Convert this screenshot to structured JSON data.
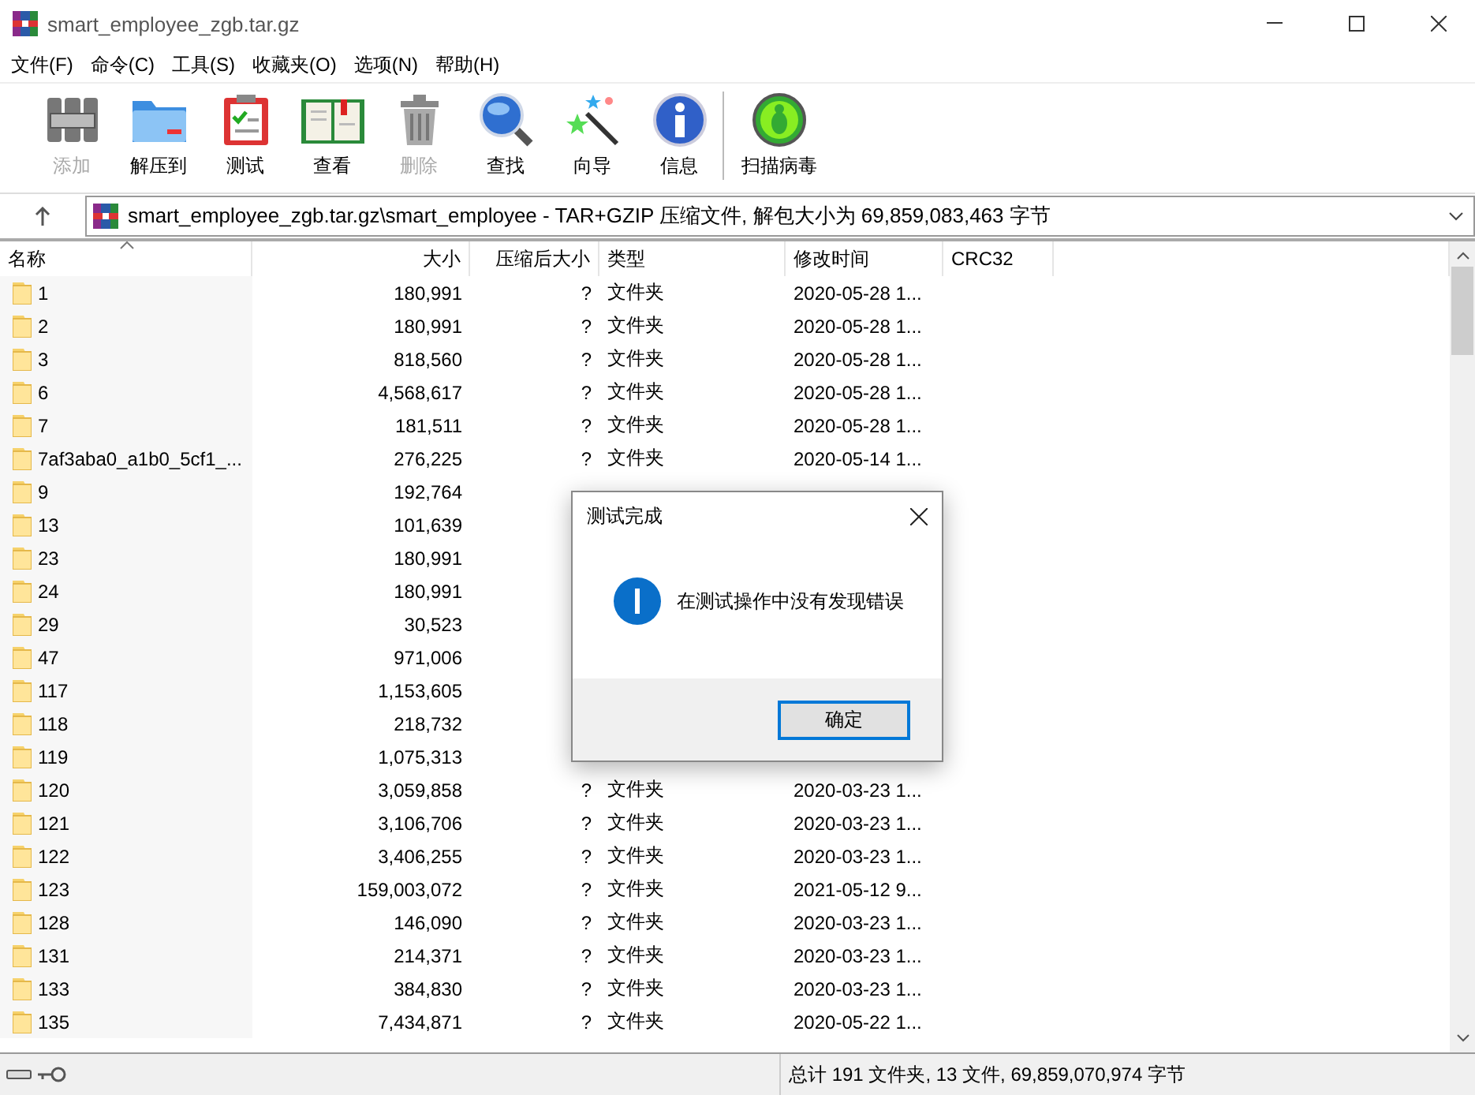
{
  "window": {
    "title": "smart_employee_zgb.tar.gz"
  },
  "menu": [
    "文件(F)",
    "命令(C)",
    "工具(S)",
    "收藏夹(O)",
    "选项(N)",
    "帮助(H)"
  ],
  "toolbar": [
    {
      "kind": "add",
      "label": "添加",
      "disabled": true
    },
    {
      "kind": "extract",
      "label": "解压到",
      "disabled": false
    },
    {
      "kind": "test",
      "label": "测试",
      "disabled": false
    },
    {
      "kind": "view",
      "label": "查看",
      "disabled": false
    },
    {
      "kind": "delete",
      "label": "删除",
      "disabled": true
    },
    {
      "kind": "find",
      "label": "查找",
      "disabled": false
    },
    {
      "kind": "wizard",
      "label": "向导",
      "disabled": false
    },
    {
      "kind": "info",
      "label": "信息",
      "disabled": false
    },
    {
      "kind": "virus",
      "label": "扫描病毒",
      "disabled": false
    }
  ],
  "address": {
    "path": "smart_employee_zgb.tar.gz\\smart_employee - TAR+GZIP 压缩文件, 解包大小为 69,859,083,463 字节"
  },
  "table": {
    "columns": [
      "名称",
      "大小",
      "压缩后大小",
      "类型",
      "修改时间",
      "CRC32"
    ],
    "rows": [
      {
        "name": "1",
        "size": "180,991",
        "packed": "?",
        "type": "文件夹",
        "modified": "2020-05-28 1..."
      },
      {
        "name": "2",
        "size": "180,991",
        "packed": "?",
        "type": "文件夹",
        "modified": "2020-05-28 1..."
      },
      {
        "name": "3",
        "size": "818,560",
        "packed": "?",
        "type": "文件夹",
        "modified": "2020-05-28 1..."
      },
      {
        "name": "6",
        "size": "4,568,617",
        "packed": "?",
        "type": "文件夹",
        "modified": "2020-05-28 1..."
      },
      {
        "name": "7",
        "size": "181,511",
        "packed": "?",
        "type": "文件夹",
        "modified": "2020-05-28 1..."
      },
      {
        "name": "7af3aba0_a1b0_5cf1_...",
        "size": "276,225",
        "packed": "?",
        "type": "文件夹",
        "modified": "2020-05-14 1..."
      },
      {
        "name": "9",
        "size": "192,764"
      },
      {
        "name": "13",
        "size": "101,639"
      },
      {
        "name": "23",
        "size": "180,991"
      },
      {
        "name": "24",
        "size": "180,991"
      },
      {
        "name": "29",
        "size": "30,523"
      },
      {
        "name": "47",
        "size": "971,006"
      },
      {
        "name": "117",
        "size": "1,153,605"
      },
      {
        "name": "118",
        "size": "218,732"
      },
      {
        "name": "119",
        "size": "1,075,313"
      },
      {
        "name": "120",
        "size": "3,059,858",
        "packed": "?",
        "type": "文件夹",
        "modified": "2020-03-23 1..."
      },
      {
        "name": "121",
        "size": "3,106,706",
        "packed": "?",
        "type": "文件夹",
        "modified": "2020-03-23 1..."
      },
      {
        "name": "122",
        "size": "3,406,255",
        "packed": "?",
        "type": "文件夹",
        "modified": "2020-03-23 1..."
      },
      {
        "name": "123",
        "size": "159,003,072",
        "packed": "?",
        "type": "文件夹",
        "modified": "2021-05-12 9..."
      },
      {
        "name": "128",
        "size": "146,090",
        "packed": "?",
        "type": "文件夹",
        "modified": "2020-03-23 1..."
      },
      {
        "name": "131",
        "size": "214,371",
        "packed": "?",
        "type": "文件夹",
        "modified": "2020-03-23 1..."
      },
      {
        "name": "133",
        "size": "384,830",
        "packed": "?",
        "type": "文件夹",
        "modified": "2020-03-23 1..."
      },
      {
        "name": "135",
        "size": "7,434,871",
        "packed": "?",
        "type": "文件夹",
        "modified": "2020-05-22 1..."
      }
    ]
  },
  "status_bar": {
    "summary": "总计 191 文件夹, 13 文件, 69,859,070,974 字节"
  },
  "dialog": {
    "title": "测试完成",
    "message": "在测试操作中没有发现错误",
    "buttons": [
      {
        "label": "确定",
        "selected": true
      }
    ]
  }
}
